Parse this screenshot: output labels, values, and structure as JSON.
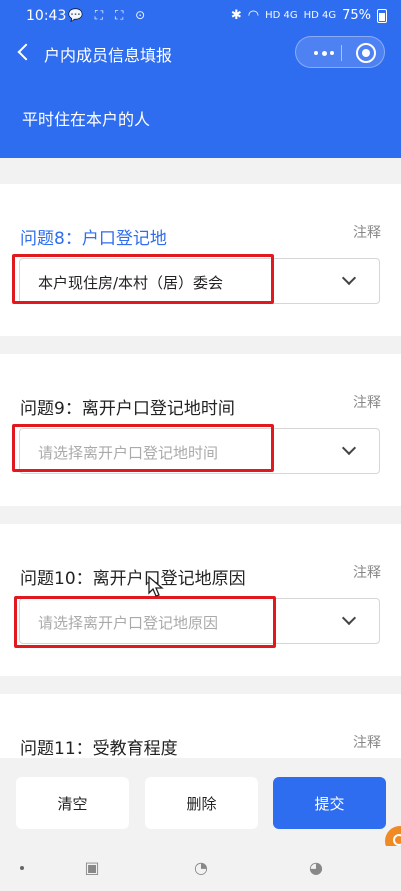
{
  "status_bar": {
    "time": "10:43",
    "left_icons": "💬 ⛶ ⛶ ⊙",
    "network_1": "HD 4G",
    "network_2": "HD 4G",
    "battery": "75%"
  },
  "nav": {
    "title": "户内成员信息填报"
  },
  "subheader": {
    "text": "平时住在本户的人"
  },
  "questions": [
    {
      "title": "问题8：户口登记地",
      "note": "注释",
      "value": "本户现住房/本村（居）委会",
      "placeholder": ""
    },
    {
      "title": "问题9：离开户口登记地时间",
      "note": "注释",
      "value": "",
      "placeholder": "请选择离开户口登记地时间"
    },
    {
      "title": "问题10：离开户口登记地原因",
      "note": "注释",
      "value": "",
      "placeholder": "请选择离开户口登记地原因"
    },
    {
      "title": "问题11：受教育程度",
      "note": "注释"
    }
  ],
  "buttons": {
    "clear": "清空",
    "delete": "删除",
    "submit": "提交"
  },
  "colors": {
    "primary": "#2f6df0",
    "highlight": "#e0191e",
    "background": "#f2f2f2"
  },
  "system_nav": {
    "icons": [
      "circle-dot-icon",
      "chat-icon",
      "cat-icon",
      "bird-icon"
    ]
  }
}
